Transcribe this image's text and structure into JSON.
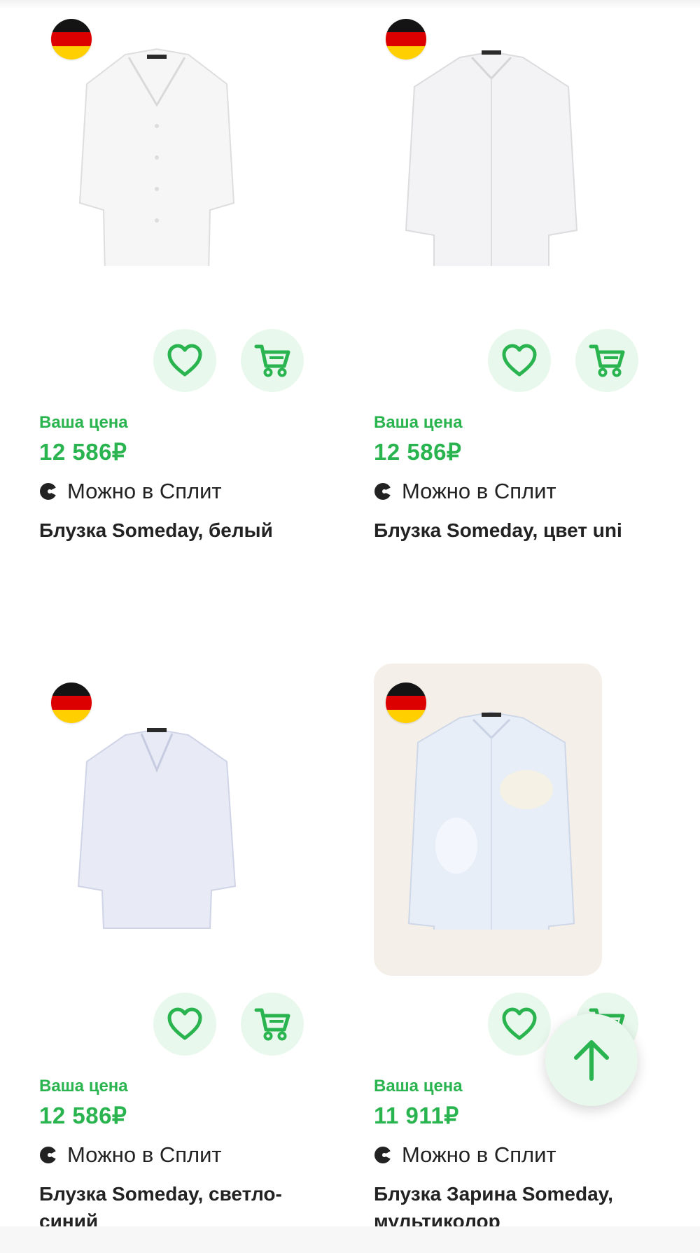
{
  "colors": {
    "accent": "#2ab44f",
    "button_bg": "#e9f8ec",
    "text": "#222222"
  },
  "products": [
    {
      "price_label": "Ваша цена",
      "price": "12 586₽",
      "split_text": "Можно в Сплит",
      "title": "Блузка Someday, белый",
      "origin_flag": "germany-flag-icon"
    },
    {
      "price_label": "Ваша цена",
      "price": "12 586₽",
      "split_text": "Можно в Сплит",
      "title": "Блузка Someday, цвет uni",
      "origin_flag": "germany-flag-icon"
    },
    {
      "price_label": "Ваша цена",
      "price": "12 586₽",
      "split_text": "Можно в Сплит",
      "title": "Блузка Someday, светло-синий",
      "origin_flag": "germany-flag-icon"
    },
    {
      "price_label": "Ваша цена",
      "price": "11 911₽",
      "split_text": "Можно в Сплит",
      "title": "Блузка Зарина Someday, мультиколор",
      "origin_flag": "germany-flag-icon"
    }
  ],
  "icons": {
    "favorite": "heart-icon",
    "cart": "cart-icon",
    "split": "split-icon",
    "scroll_top": "arrow-up-icon"
  }
}
